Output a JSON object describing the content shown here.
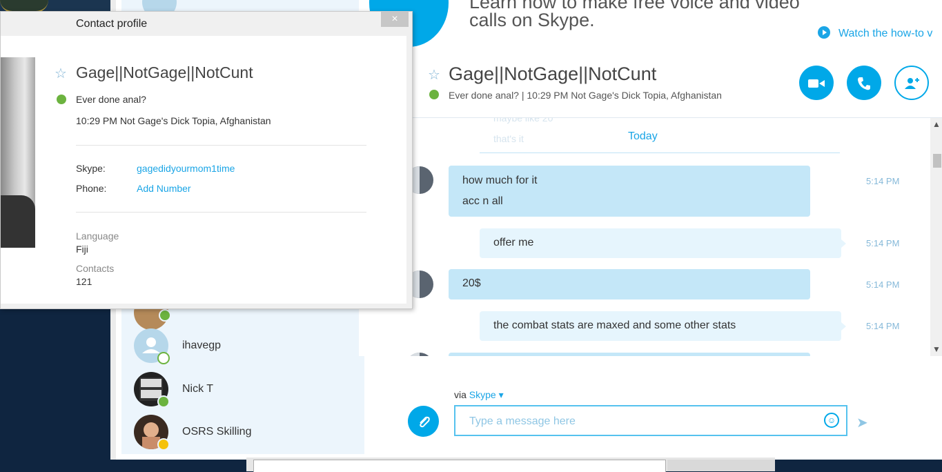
{
  "profile": {
    "window_title": "Contact profile",
    "close_glyph": "×",
    "name": "Gage||NotGage||NotCunt",
    "mood": "Ever done anal?",
    "local_time_location": "10:29 PM Not Gage's Dick Topia, Afghanistan",
    "skype_label": "Skype:",
    "skype_id": "gagedidyourmom1time",
    "phone_label": "Phone:",
    "phone_value": "Add Number",
    "language_label": "Language",
    "language_value": "Fiji",
    "contacts_label": "Contacts",
    "contacts_value": "121",
    "status": "online"
  },
  "banner": {
    "promo_line1": "Learn how to make free voice and video",
    "promo_line2": "calls on Skype.",
    "watch_link": "Watch the how-to v"
  },
  "chat_header": {
    "name": "Gage||NotGage||NotCunt",
    "mood_and_time": "Ever done anal?  |  10:29 PM Not Gage's Dick Topia, Afghanistan",
    "video_call_icon": "video-camera-icon",
    "voice_call_icon": "phone-icon",
    "add_contact_icon": "add-person-icon"
  },
  "contacts": [
    {
      "name": "ihavegp",
      "status": "offline"
    },
    {
      "name": "Nick T",
      "status": "online"
    },
    {
      "name": "OSRS Skilling",
      "status": "away"
    }
  ],
  "messages": {
    "ghost_lines": [
      "maybe like 20",
      "that's it"
    ],
    "date_divider": "Today",
    "items": [
      {
        "direction": "in",
        "lines": [
          "how much for it",
          "acc n all"
        ],
        "time": "5:14 PM"
      },
      {
        "direction": "out",
        "lines": [
          "offer me"
        ],
        "time": "5:14 PM"
      },
      {
        "direction": "in",
        "lines": [
          "20$"
        ],
        "time": "5:14 PM"
      },
      {
        "direction": "out",
        "lines": [
          "the combat stats are maxed and some other stats"
        ],
        "time": "5:14 PM"
      }
    ]
  },
  "compose": {
    "via_prefix": "via",
    "via_service": "Skype",
    "via_dropdown_icon": "caret-down-icon",
    "placeholder": "Type a message here",
    "attach_icon": "paperclip-icon",
    "emoji_icon": "smiley-icon",
    "send_icon": "send-arrow-icon"
  },
  "colors": {
    "skype_blue": "#00a8e8",
    "bubble_in": "#c4e7f8",
    "bubble_out": "#e6f5fd",
    "online": "#6cb33f",
    "away": "#f5c20a"
  }
}
